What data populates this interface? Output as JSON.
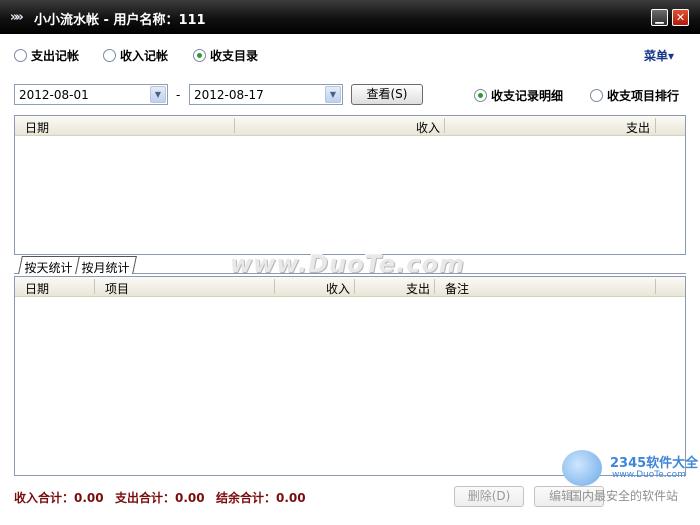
{
  "window": {
    "logo": "»»",
    "title": "小小流水帐 - 用户名称：111",
    "minimize": "▁",
    "close": "✕"
  },
  "modes": [
    {
      "label": "支出记帐",
      "selected": false
    },
    {
      "label": "收入记帐",
      "selected": false
    },
    {
      "label": "收支目录",
      "selected": true
    }
  ],
  "menu_label": "菜单▾",
  "filter": {
    "start_date": "2012-08-01",
    "separator": "-",
    "end_date": "2012-08-17",
    "view_button": "查看(S)",
    "view_options": [
      {
        "label": "收支记录明细",
        "selected": true
      },
      {
        "label": "收支项目排行",
        "selected": false
      }
    ]
  },
  "summary_table": {
    "columns": [
      "日期",
      "收入",
      "支出"
    ],
    "rows": []
  },
  "tabs": [
    "按天统计",
    "按月统计"
  ],
  "watermark": "www.DuoTe.com",
  "detail_table": {
    "columns": [
      "日期",
      "项目",
      "收入",
      "支出",
      "备注"
    ],
    "rows": []
  },
  "totals": {
    "income": "收入合计：0.00",
    "expense": "支出合计：0.00",
    "balance": "结余合计：0.00"
  },
  "buttons": {
    "delete": "删除(D)",
    "edit": "编辑"
  },
  "brand": {
    "name": "2345软件大全",
    "url": "www.DuoTe.com",
    "slogan": "国内最安全的软件站"
  }
}
